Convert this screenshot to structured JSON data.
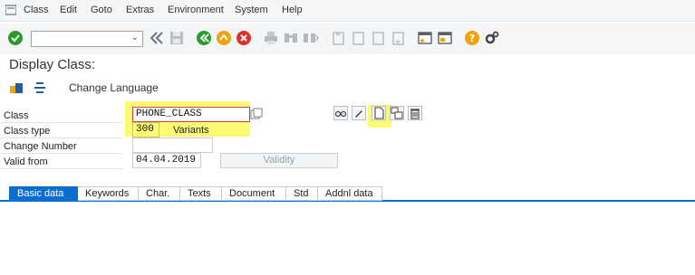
{
  "menu": {
    "items": [
      {
        "label": "Class"
      },
      {
        "label": "Edit"
      },
      {
        "label": "Goto"
      },
      {
        "label": "Extras"
      },
      {
        "label": "Environment"
      },
      {
        "label": "System"
      },
      {
        "label": "Help"
      }
    ]
  },
  "toolbar": {
    "command_field_value": ""
  },
  "page": {
    "title": "Display Class:"
  },
  "app_toolbar": {
    "change_language_label": "Change Language"
  },
  "form": {
    "class_label": "Class",
    "class_value": "PHONE_CLASS",
    "class_type_label": "Class type",
    "class_type_value": "300",
    "class_type_text": "Variants",
    "change_number_label": "Change Number",
    "change_number_value": "",
    "valid_from_label": "Valid from",
    "valid_from_value": "04.04.2019",
    "validity_button_label": "Validity"
  },
  "tabs": [
    {
      "label": "Basic data"
    },
    {
      "label": "Keywords"
    },
    {
      "label": "Char."
    },
    {
      "label": "Texts"
    },
    {
      "label": "Document"
    },
    {
      "label": "Std"
    },
    {
      "label": "Addnl data"
    }
  ],
  "colors": {
    "accent": "#0a6ed1",
    "highlight": "#fbfb74",
    "ok_green": "#2b9a2b",
    "back_green": "#2b9a2b",
    "exit_orange": "#f0a30a",
    "cancel_red": "#e0302a",
    "help_orange": "#f0a30a"
  }
}
